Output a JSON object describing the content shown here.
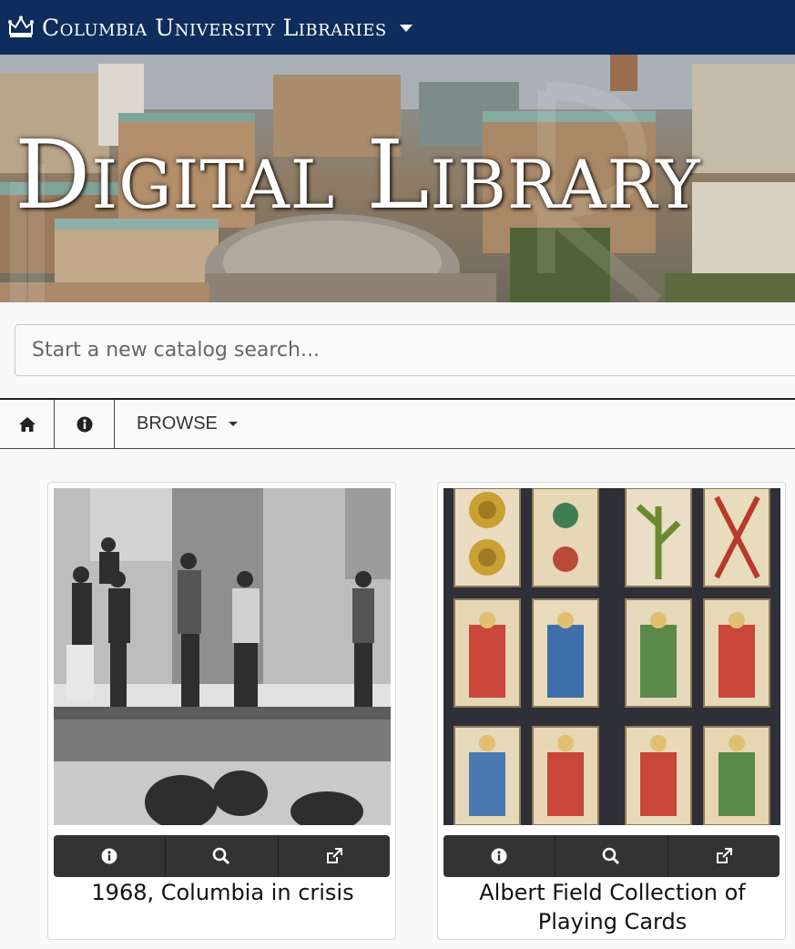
{
  "header": {
    "brand": "Columbia University Libraries",
    "icon": "crown-icon"
  },
  "banner": {
    "title": "Digital Library"
  },
  "search": {
    "placeholder": "Start a new catalog search..."
  },
  "nav": {
    "home_icon": "home-icon",
    "info_icon": "info-icon",
    "browse_label": "BROWSE"
  },
  "cards": [
    {
      "title": "1968, Columbia in crisis",
      "actions": [
        "info-icon",
        "search-icon",
        "external-link-icon"
      ]
    },
    {
      "title": "Albert Field Collection of Playing Cards",
      "actions": [
        "info-icon",
        "search-icon",
        "external-link-icon"
      ]
    }
  ],
  "colors": {
    "header_bg": "#0e2d5c",
    "action_bar_bg": "#333333"
  }
}
